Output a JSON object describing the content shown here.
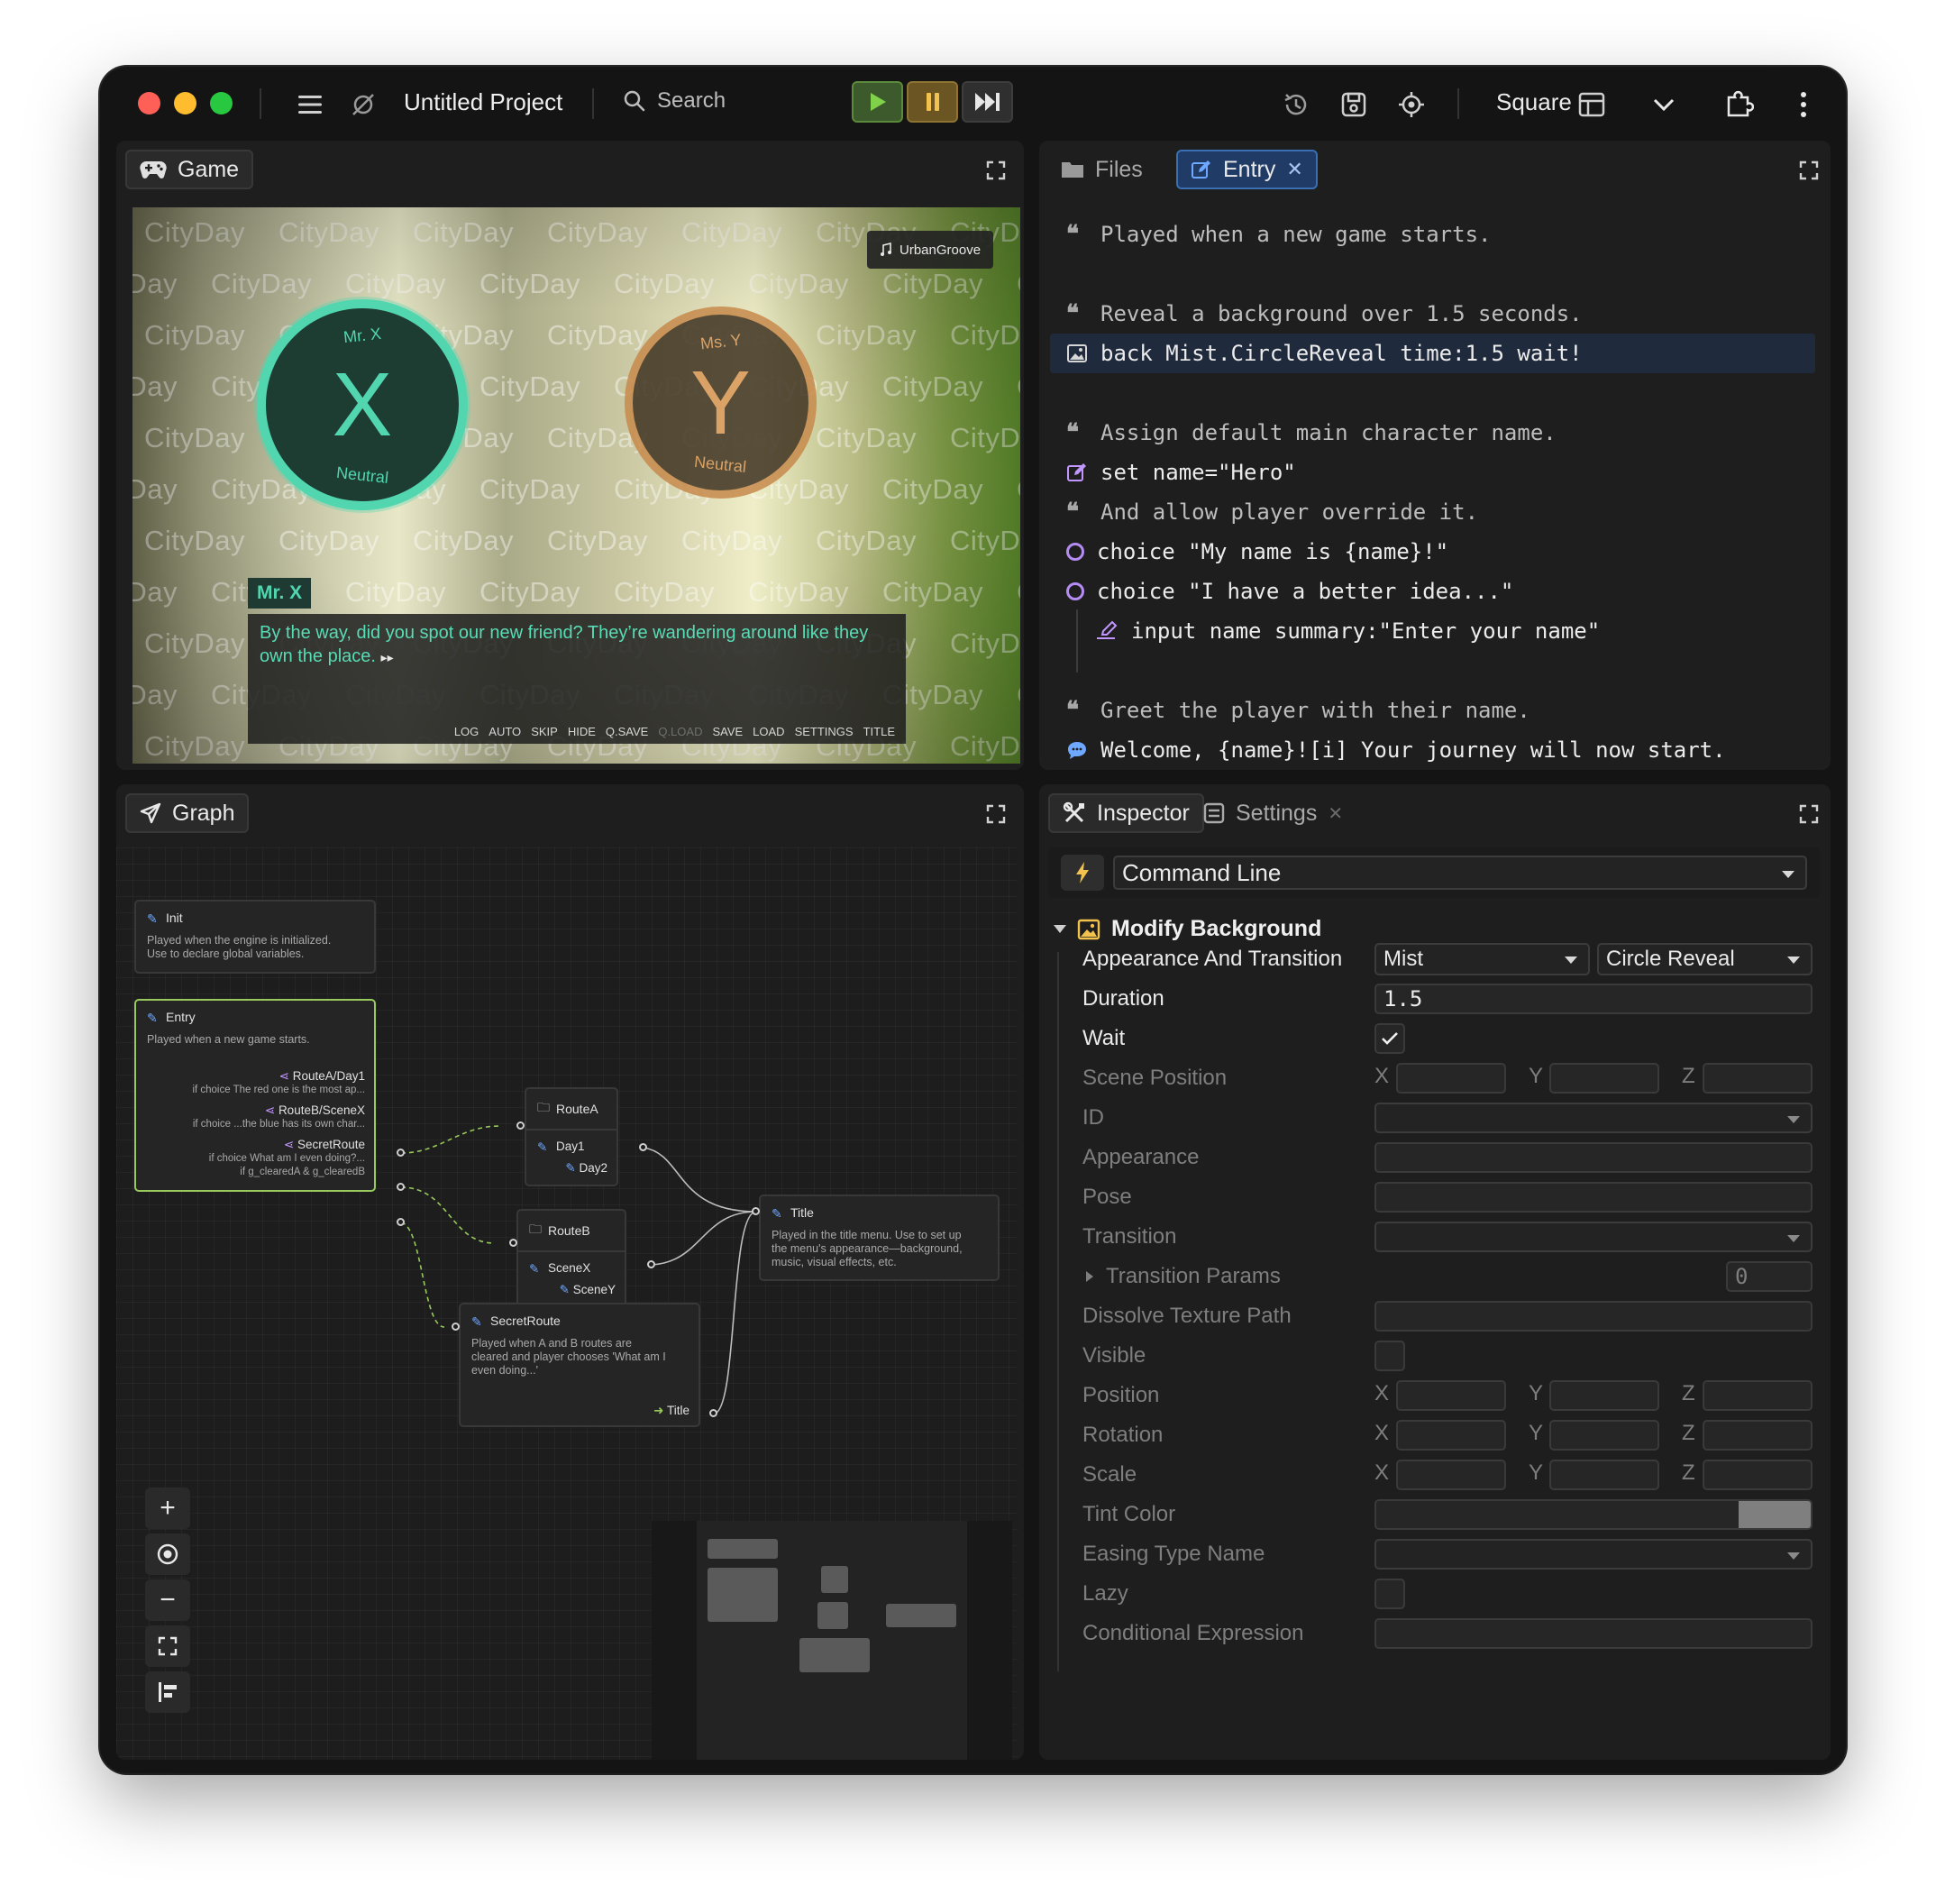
{
  "titlebar": {
    "project_title": "Untitled Project",
    "search_placeholder": "Search",
    "layout_label": "Square"
  },
  "game_panel": {
    "tab_label": "Game",
    "watermark": "CityDay",
    "music_label": "UrbanGroove",
    "char_x": {
      "letter": "X",
      "name": "Mr. X",
      "mood": "Neutral"
    },
    "char_y": {
      "letter": "Y",
      "name": "Ms. Y",
      "mood": "Neutral"
    },
    "speaker": "Mr. X",
    "dialog_text": "By the way, did you spot our new friend? They’re wandering around like they own the place.",
    "dialog_menu": [
      "LOG",
      "AUTO",
      "SKIP",
      "HIDE",
      "Q.SAVE",
      "Q.LOAD",
      "SAVE",
      "LOAD",
      "SETTINGS",
      "TITLE"
    ]
  },
  "editor_panel": {
    "tabs": [
      {
        "label": "Files"
      },
      {
        "label": "Entry"
      }
    ],
    "lines": [
      {
        "kind": "comment",
        "text": "Played when a new game starts."
      },
      {
        "kind": "comment",
        "text": "Reveal a background over 1.5 seconds."
      },
      {
        "kind": "cmd",
        "text": "back Mist.CircleReveal time:1.5 wait!"
      },
      {
        "kind": "comment",
        "text": "Assign default main character name."
      },
      {
        "kind": "cmd",
        "text": "set name=\"Hero\""
      },
      {
        "kind": "comment",
        "text": "And allow player override it."
      },
      {
        "kind": "cmd",
        "text": "choice \"My name is {name}!\""
      },
      {
        "kind": "cmd",
        "text": "choice \"I have a better idea...\""
      },
      {
        "kind": "cmd",
        "text": "input name summary:\"Enter your name\""
      },
      {
        "kind": "comment",
        "text": "Greet the player with their name."
      },
      {
        "kind": "cmd",
        "text": "Welcome, {name}![i] Your journey will now start."
      }
    ]
  },
  "graph_panel": {
    "tab_label": "Graph",
    "nodes": {
      "init": {
        "title": "Init",
        "desc1": "Played when the engine is initialized.",
        "desc2": "Use to declare global variables."
      },
      "entry": {
        "title": "Entry",
        "desc": "Played when a new game starts.",
        "out1": "RouteA/Day1",
        "out1_sub": "if choice The red one is the most ap...",
        "out2": "RouteB/SceneX",
        "out2_sub": "if choice ...the blue has its own char...",
        "out3": "SecretRoute",
        "out3_sub1": "if choice What am I even doing?...",
        "out3_sub2": "if g_clearedA & g_clearedB"
      },
      "routeA": {
        "title": "RouteA",
        "in": "Day1",
        "out": "Day2"
      },
      "routeB": {
        "title": "RouteB",
        "in": "SceneX",
        "out": "SceneY"
      },
      "title": {
        "title": "Title",
        "desc1": "Played in the title menu. Use to set up",
        "desc2": "the menu's appearance—background,",
        "desc3": "music, visual effects, etc."
      },
      "secret": {
        "title": "SecretRoute",
        "desc1": "Played when A and B routes are",
        "desc2": "cleared and player chooses 'What am I",
        "desc3": "even doing...'",
        "out": "Title"
      }
    }
  },
  "inspector_panel": {
    "tabs": [
      {
        "label": "Inspector"
      },
      {
        "label": "Settings"
      }
    ],
    "command_selector": "Command Line",
    "section_title": "Modify Background",
    "appearance_label": "Appearance And Transition",
    "appearance_value": "Mist",
    "transition_value": "Circle Reveal",
    "duration_label": "Duration",
    "duration_value": "1.5",
    "wait_label": "Wait",
    "wait_checked": true,
    "scene_position_label": "Scene Position",
    "id_label": "ID",
    "appearance2_label": "Appearance",
    "pose_label": "Pose",
    "transition_label": "Transition",
    "transition_params_label": "Transition Params",
    "transition_params_value": "0",
    "dissolve_label": "Dissolve Texture Path",
    "visible_label": "Visible",
    "position_label": "Position",
    "rotation_label": "Rotation",
    "scale_label": "Scale",
    "tint_label": "Tint Color",
    "tint_color": "#7f7f7f",
    "easing_label": "Easing Type Name",
    "lazy_label": "Lazy",
    "conditional_label": "Conditional Expression",
    "axis": {
      "x": "X",
      "y": "Y",
      "z": "Z"
    }
  },
  "colors": {
    "accent_teal": "#52d6b0",
    "accent_orange": "#d99757",
    "node_highlight": "#97c95d",
    "choice_purple": "#b48cf2"
  }
}
